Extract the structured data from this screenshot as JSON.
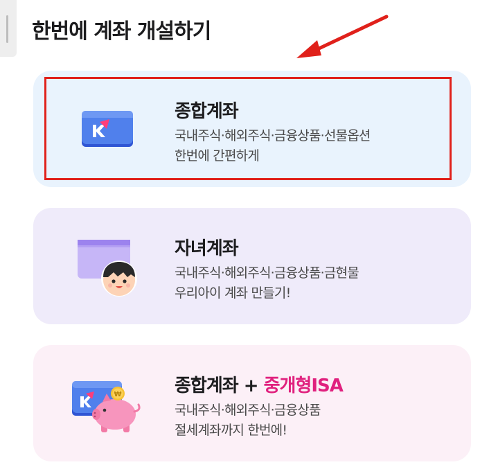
{
  "page": {
    "title": "한번에 계좌 개설하기"
  },
  "cards": [
    {
      "title": "종합계좌",
      "desc_line1": "국내주식·해외주식·금융상품·선물옵션",
      "desc_line2": "한번에 간편하게",
      "illustration": "brokerage-card-icon"
    },
    {
      "title": "자녀계좌",
      "desc_line1": "국내주식·해외주식·금융상품·금현물",
      "desc_line2": "우리아이 계좌 만들기!",
      "illustration": "child-account-icon"
    },
    {
      "title": "종합계좌 + ",
      "title_highlight": "중개형ISA",
      "desc_line1": "국내주식·해외주식·금융상품",
      "desc_line2": "절세계좌까지 한번에!",
      "illustration": "piggy-bank-icon"
    }
  ],
  "colors": {
    "card1_bg": "#e9f3fd",
    "card2_bg": "#efebfa",
    "card3_bg": "#fcf0f7",
    "highlight_border": "#e0211b",
    "isa_accent": "#e0217e"
  }
}
